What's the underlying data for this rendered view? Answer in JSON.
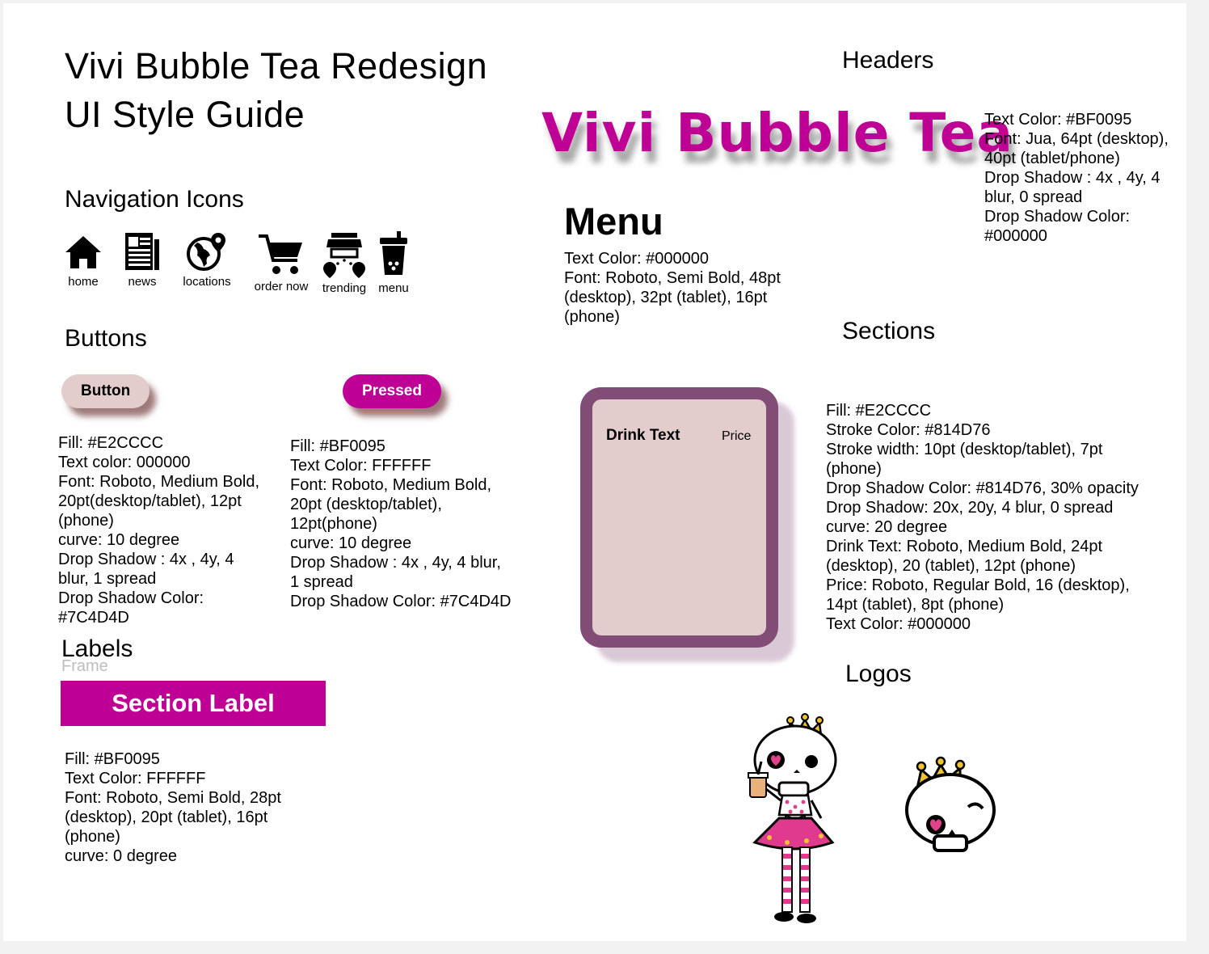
{
  "page": {
    "title_line1": "Vivi Bubble Tea Redesign",
    "title_line2": "UI Style Guide"
  },
  "navigation": {
    "heading": "Navigation Icons",
    "icons": [
      {
        "label": "home",
        "icon": "home-icon"
      },
      {
        "label": "news",
        "icon": "news-icon"
      },
      {
        "label": "locations",
        "icon": "globe-pin-icon"
      },
      {
        "label": "order now",
        "icon": "cart-icon"
      },
      {
        "label": "trending",
        "icon": "storefront-icon"
      },
      {
        "label": "menu",
        "icon": "bubble-tea-cup-icon"
      }
    ]
  },
  "buttons": {
    "heading": "Buttons",
    "normal": {
      "label": "Button",
      "spec": "Fill: #E2CCCC\nText color: 000000\nFont: Roboto, Medium Bold,\n20pt(desktop/tablet), 12pt\n(phone)\ncurve: 10 degree\nDrop Shadow : 4x , 4y, 4\nblur, 1 spread\nDrop Shadow Color:\n#7C4D4D"
    },
    "pressed": {
      "label": "Pressed",
      "spec": "Fill: #BF0095\nText Color: FFFFFF\nFont: Roboto, Medium Bold,\n20pt (desktop/tablet),\n12pt(phone)\ncurve: 10 degree\nDrop Shadow : 4x , 4y, 4 blur,\n1 spread\nDrop Shadow Color: #7C4D4D"
    }
  },
  "labels": {
    "heading": "Labels",
    "frame_caption": "Frame",
    "section_label": "Section Label",
    "spec": "Fill: #BF0095\nText Color: FFFFFF\nFont: Roboto, Semi Bold, 28pt\n(desktop), 20pt (tablet), 16pt\n(phone)\ncurve: 0 degree"
  },
  "headers": {
    "heading": "Headers",
    "brand_text": "Vivi Bubble Tea",
    "brand_spec": "Text Color: #BF0095\nFont: Jua, 64pt (desktop),\n40pt (tablet/phone)\nDrop Shadow : 4x , 4y, 4\nblur, 0 spread\nDrop Shadow Color:\n#000000",
    "menu_text": "Menu",
    "menu_spec": "Text Color: #000000\nFont: Roboto, Semi Bold, 48pt\n(desktop), 32pt (tablet), 16pt\n(phone)"
  },
  "sections": {
    "heading": "Sections",
    "drink_text": "Drink Text",
    "price_text": "Price",
    "spec": "Fill: #E2CCCC\nStroke Color: #814D76\nStroke width: 10pt (desktop/tablet), 7pt\n(phone)\nDrop Shadow Color: #814D76, 30% opacity\nDrop Shadow: 20x, 20y, 4 blur, 0 spread\ncurve: 20 degree\nDrink Text: Roboto, Medium Bold, 24pt\n(desktop), 20 (tablet), 12pt (phone)\nPrice: Roboto, Regular Bold, 16 (desktop),\n14pt (tablet), 8pt (phone)\nText Color: #000000"
  },
  "logos": {
    "heading": "Logos",
    "items": [
      "skeleton-girl-mascot-logo",
      "crowned-skull-logo"
    ]
  },
  "colors": {
    "brand_magenta": "#BF0095",
    "button_fill": "#E2CCCC",
    "section_stroke": "#814D76",
    "shadow": "#7C4D4D",
    "crown": "#F2C230"
  }
}
